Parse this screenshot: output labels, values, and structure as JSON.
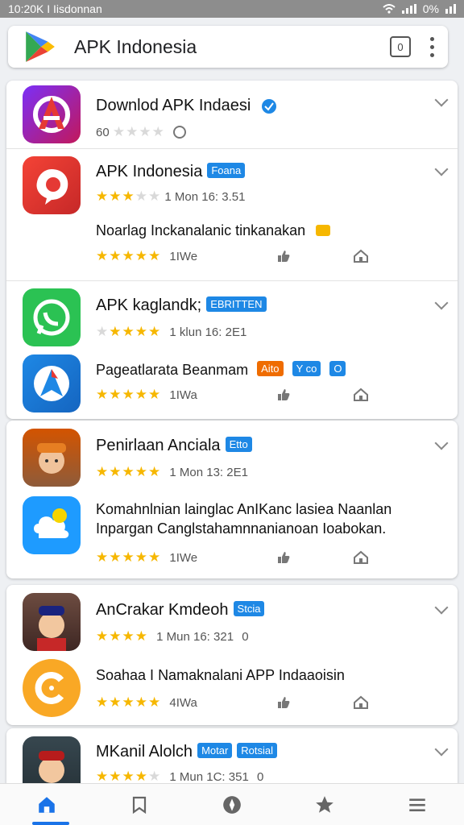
{
  "status": {
    "time_carrier": "10:20K I Iisdonnan",
    "battery": "0%"
  },
  "search": {
    "title": "APK Indonesia",
    "tab_count": "0"
  },
  "cards": [
    {
      "title": "Downlod APK Indaesi",
      "badge": "",
      "meta": "60",
      "extra": ""
    },
    {
      "title": "APK Indonesia",
      "badge": "Foana",
      "meta": "1 Mon 16: 3.51",
      "desc": "Noarlag Inckanalanic tinkanakan",
      "footer": "1IWe"
    },
    {
      "title": "APK kaglandk;",
      "badge": "EBRITTEN",
      "meta": "1 klun 16: 2E1",
      "desc": "Pageatlarata Beanmam",
      "desc_badges": [
        "Aito",
        "Y co",
        "O"
      ],
      "footer": "1IWa"
    },
    {
      "title": "Penirlaan Anciala",
      "badge": "Etto",
      "meta": "1 Mon 13: 2E1",
      "desc": "Komahnlnian lainglac AnIKanc lasiea Naanlan",
      "desc2": "Inpargan Canglstahamnnanianoan Ioabokan.",
      "footer": "1IWe"
    },
    {
      "title": "AnCrakar Kmdeoh",
      "badge": "Stcia",
      "meta": "1 Mun 16: 321",
      "meta_extra": "0",
      "desc": "Soahaa I Namaknalani APP Indaaoisin",
      "footer": "4IWa"
    },
    {
      "title": "MKanil Alolch",
      "badge": "Motar",
      "badge2": "Rotsial",
      "meta": "1 Mun 1C: 351",
      "meta_extra": "0"
    }
  ],
  "colors": {
    "accent": "#1a73e8",
    "star": "#f6b700",
    "badge": "#1e88e5"
  },
  "icons": {
    "nav": [
      "home-icon",
      "bookmark-icon",
      "compass-icon",
      "star-icon",
      "menu-icon"
    ]
  }
}
